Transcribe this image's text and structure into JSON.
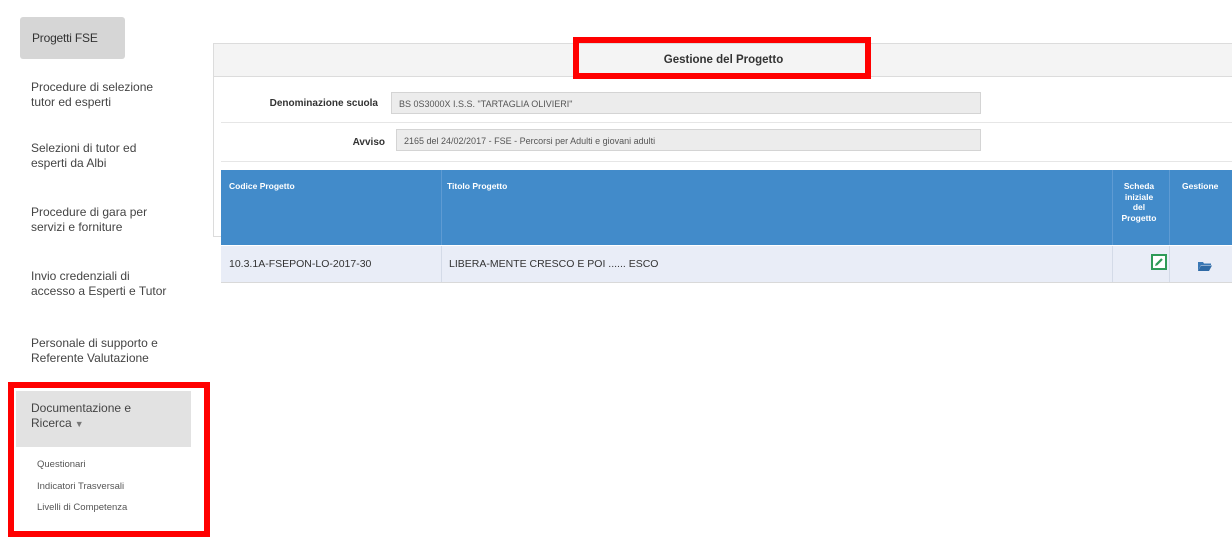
{
  "sidebar": {
    "top_button": "Progetti FSE",
    "items": [
      {
        "line1": "Procedure di selezione",
        "line2": "tutor ed esperti"
      },
      {
        "line1": "Selezioni di tutor ed",
        "line2": "esperti da Albi"
      },
      {
        "line1": "Procedure di gara per",
        "line2": "servizi e forniture"
      },
      {
        "line1": "Invio credenziali di",
        "line2": "accesso a Esperti e Tutor"
      },
      {
        "line1": "Personale di supporto e",
        "line2": "Referente Valutazione"
      },
      {
        "line1": "Documentazione e",
        "line2": "Ricerca"
      }
    ],
    "subitems": [
      "Questionari",
      "Indicatori Trasversali",
      "Livelli di Competenza"
    ]
  },
  "panel": {
    "title": "Gestione del Progetto",
    "fields": [
      {
        "label": "Denominazione scuola",
        "value": "BS 0S3000X I.S.S. \"TARTAGLIA OLIVIERI\""
      },
      {
        "label": "Avviso",
        "value": "2165 del 24/02/2017 - FSE - Percorsi per Adulti e giovani adulti"
      }
    ]
  },
  "table": {
    "headers": {
      "code": "Codice Progetto",
      "title": "Titolo Progetto",
      "scheda": [
        "Scheda",
        "iniziale",
        "del",
        "Progetto"
      ],
      "gestione": "Gestione"
    },
    "rows": [
      {
        "code": "10.3.1A-FSEPON-LO-2017-30",
        "title": "LIBERA-MENTE CRESCO E POI ...... ESCO"
      }
    ]
  },
  "colors": {
    "table_header": "#428bca",
    "highlight_border": "#ff0000",
    "edit_icon": "#2e9b57",
    "folder_icon": "#3a78b5"
  },
  "icons": {
    "scheda": "edit-icon",
    "gestione": "folder-open-icon",
    "dropdown": "caret-down-icon"
  }
}
